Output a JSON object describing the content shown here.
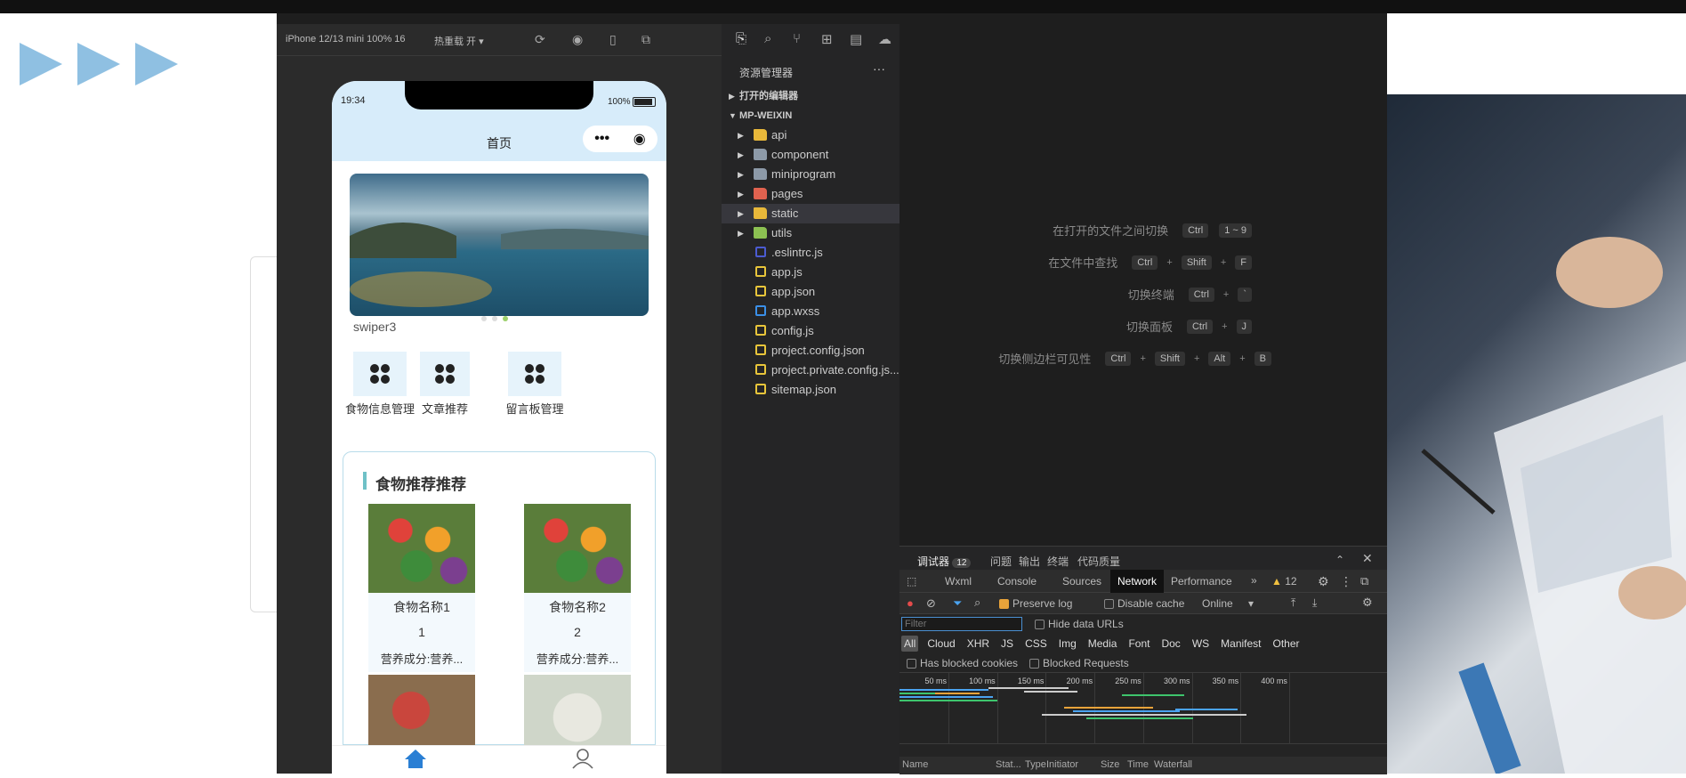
{
  "simulator": {
    "device": "iPhone 12/13 mini 100% 16",
    "hot_reload": "热重载 开",
    "status_time": "19:34",
    "battery": "100%",
    "nav_title": "首页",
    "swiper_caption": "swiper3",
    "grid_items": [
      {
        "label": "食物信息管理"
      },
      {
        "label": "文章推荐"
      },
      {
        "label": "留言板管理"
      }
    ],
    "section_title": "食物推荐推荐",
    "foods": [
      {
        "name": "食物名称1",
        "value": "1",
        "nutrition": "营养成分:营养..."
      },
      {
        "name": "食物名称2",
        "value": "2",
        "nutrition": "营养成分:营养..."
      }
    ],
    "tabbar": [
      {
        "label": "首页",
        "icon": "home-icon",
        "color": "#2a7fd4"
      },
      {
        "label": "我的",
        "icon": "user-icon",
        "color": "#666666"
      }
    ]
  },
  "explorer": {
    "title": "资源管理器",
    "open_editors": "打开的编辑器",
    "project": "MP-WEIXIN",
    "items": [
      {
        "name": "api",
        "type": "folder",
        "color": "#e8b83a",
        "expandable": true
      },
      {
        "name": "component",
        "type": "folder",
        "color": "#8d9aa8",
        "expandable": true
      },
      {
        "name": "miniprogram",
        "type": "folder",
        "color": "#8d9aa8",
        "expandable": true
      },
      {
        "name": "pages",
        "type": "folder",
        "color": "#e0624f",
        "expandable": true
      },
      {
        "name": "static",
        "type": "folder",
        "color": "#e8b83a",
        "expandable": true,
        "selected": true
      },
      {
        "name": "utils",
        "type": "folder",
        "color": "#8cc152",
        "expandable": true
      },
      {
        "name": ".eslintrc.js",
        "type": "file",
        "color": "#4b5bd1"
      },
      {
        "name": "app.js",
        "type": "file",
        "color": "#e8c53a"
      },
      {
        "name": "app.json",
        "type": "file",
        "color": "#e8c53a"
      },
      {
        "name": "app.wxss",
        "type": "file",
        "color": "#3a8fe8"
      },
      {
        "name": "config.js",
        "type": "file",
        "color": "#e8c53a"
      },
      {
        "name": "project.config.json",
        "type": "file",
        "color": "#e8c53a"
      },
      {
        "name": "project.private.config.js...",
        "type": "file",
        "color": "#e8c53a"
      },
      {
        "name": "sitemap.json",
        "type": "file",
        "color": "#e8c53a"
      }
    ]
  },
  "editor": {
    "shortcuts": [
      {
        "label": "在打开的文件之间切换",
        "keys": [
          "Ctrl",
          "1 ~ 9"
        ]
      },
      {
        "label": "在文件中查找",
        "keys": [
          "Ctrl",
          "+",
          "Shift",
          "+",
          "F"
        ]
      },
      {
        "label": "切换终端",
        "keys": [
          "Ctrl",
          "+",
          "`"
        ]
      },
      {
        "label": "切换面板",
        "keys": [
          "Ctrl",
          "+",
          "J"
        ]
      },
      {
        "label": "切换侧边栏可见性",
        "keys": [
          "Ctrl",
          "+",
          "Shift",
          "+",
          "Alt",
          "+",
          "B"
        ]
      }
    ]
  },
  "devtools": {
    "top_tabs": [
      {
        "label": "调试器",
        "badge": "12"
      },
      {
        "label": "问题"
      },
      {
        "label": "输出"
      },
      {
        "label": "终端"
      },
      {
        "label": "代码质量"
      }
    ],
    "panel_tabs": [
      "Wxml",
      "Console",
      "Sources",
      "Network",
      "Performance"
    ],
    "active_panel": "Network",
    "warning_count": "12",
    "preserve_log": "Preserve log",
    "disable_cache": "Disable cache",
    "throttle": "Online",
    "filter_placeholder": "Filter",
    "hide_data_urls": "Hide data URLs",
    "type_filters": [
      "All",
      "Cloud",
      "XHR",
      "JS",
      "CSS",
      "Img",
      "Media",
      "Font",
      "Doc",
      "WS",
      "Manifest",
      "Other"
    ],
    "has_blocked_cookies": "Has blocked cookies",
    "blocked_requests": "Blocked Requests",
    "timeline_ticks": [
      "50 ms",
      "100 ms",
      "150 ms",
      "200 ms",
      "250 ms",
      "300 ms",
      "350 ms",
      "400 ms"
    ],
    "columns": [
      "Name",
      "Stat...",
      "Type",
      "Initiator",
      "Size",
      "Time",
      "Waterfall"
    ]
  }
}
